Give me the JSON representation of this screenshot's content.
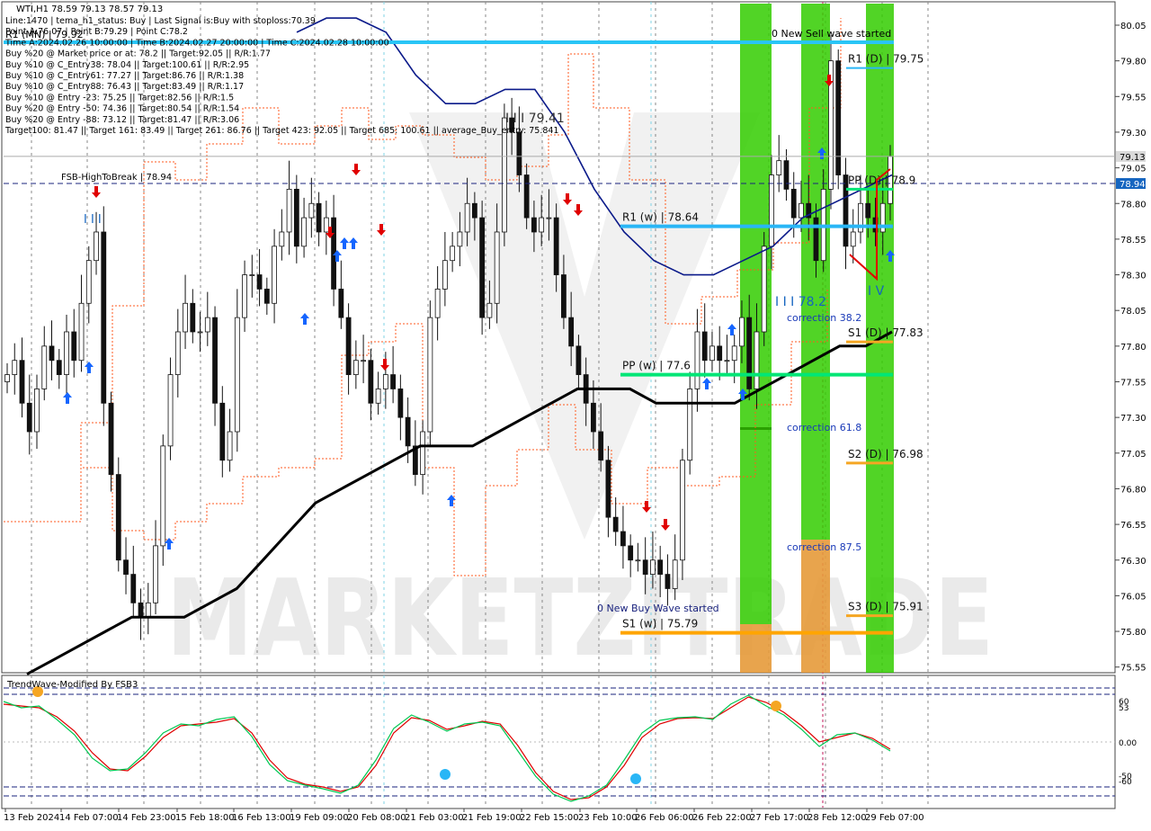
{
  "window": {
    "symbol_line": "WTI,H1  78.59 79.13 78.57 79.13",
    "info_lines": [
      "Line:1470 | tema_h1_status: Buy | Last Signal is:Buy with stoploss:70.39",
      "Point A:76.07 | Point B:79.29 | Point C:78.2",
      "Time A:2024.02.26 10:00:00 | Time B:2024.02.27 20:00:00 | Time C:2024.02.28 10:00:00",
      "Buy %20 @ Market price or at: 78.2 || Target:92.05 || R/R:1.77",
      "Buy %10 @ C_Entry38: 78.04 || Target:100.61 || R/R:2.95",
      "Buy %10 @ C_Entry61: 77.27 || Target:86.76 || R/R:1.38",
      "Buy %10 @ C_Entry88: 76.43 || Target:83.49 || R/R:1.17",
      "Buy %10 @ Entry -23: 75.25 || Target:82.56 || R/R:1.5",
      "Buy %20 @ Entry -50: 74.36 || Target:80.54 || R/R:1.54",
      "Buy %20 @ Entry -88: 73.12 || Target:81.47 || R/R:3.06",
      "Target100: 81.47 || Target 161: 83.49 || Target 261: 86.76 || Target 423: 92.05 || Target 685: 100.61 || average_Buy_entry: 75.841"
    ],
    "r1_mn_label": "R1 (MN) | 79.92",
    "watermark": "MARKETZITRADE"
  },
  "annotations": {
    "fsb_high_to_break": "FSB-HighToBreak | 78.94",
    "wave_high": "I I I 79.41",
    "wave_c": "I I I 78.2",
    "wave_iv": "I V",
    "wave_start_top": "I I I",
    "new_sell_wave": "0 New Sell wave started",
    "new_buy_wave": "0 New Buy Wave started",
    "correction_38": "correction 38.2",
    "correction_61": "correction 61.8",
    "correction_87": "correction 87.5"
  },
  "levels": [
    {
      "label": "R1 (D) | 79.75",
      "price": 79.75,
      "color": "#29b6f6"
    },
    {
      "label": "PP (D) | 78.9",
      "price": 78.9,
      "color": "#00e676"
    },
    {
      "label": "R1 (w) | 78.64",
      "price": 78.64,
      "color": "#29b6f6"
    },
    {
      "label": "S1 (D) | 77.83",
      "price": 77.83,
      "color": "#f5a623"
    },
    {
      "label": "PP (w) | 77.6",
      "price": 77.6,
      "color": "#00e676"
    },
    {
      "label": "S2 (D) | 76.98",
      "price": 76.98,
      "color": "#f5a623"
    },
    {
      "label": "S3 (D) | 75.91",
      "price": 75.91,
      "color": "#f5a623"
    },
    {
      "label": "S1 (w) | 75.79",
      "price": 75.79,
      "color": "#ffa500"
    }
  ],
  "price_axis": {
    "ticks": [
      "80.05",
      "79.80",
      "79.55",
      "79.30",
      "79.05",
      "78.80",
      "78.55",
      "78.30",
      "78.05",
      "77.80",
      "77.55",
      "77.30",
      "77.05",
      "76.80",
      "76.55",
      "76.30",
      "76.05",
      "75.80",
      "75.55"
    ],
    "current_price": "79.13",
    "current_price_color": "#d9d9d9",
    "fsb_price": "78.94",
    "fsb_price_color": "#1565c0"
  },
  "time_axis": {
    "labels": [
      "13 Feb 2024",
      "14 Feb 07:00",
      "14 Feb 23:00",
      "15 Feb 18:00",
      "16 Feb 13:00",
      "19 Feb 09:00",
      "20 Feb 08:00",
      "21 Feb 03:00",
      "21 Feb 19:00",
      "22 Feb 15:00",
      "23 Feb 10:00",
      "26 Feb 06:00",
      "26 Feb 22:00",
      "27 Feb 17:00",
      "28 Feb 12:00",
      "29 Feb 07:00"
    ]
  },
  "indicator": {
    "title": "TrendWave-Modified By FSB3",
    "ticks": [
      "60",
      "53",
      "0.00",
      "-50",
      "-60"
    ]
  },
  "chart_data": {
    "type": "candlestick",
    "symbol": "WTI",
    "timeframe": "H1",
    "ohlc_last": {
      "open": 78.59,
      "high": 79.13,
      "low": 78.57,
      "close": 79.13
    },
    "ylim": [
      75.5,
      80.1
    ],
    "series": [
      {
        "name": "price (approx close)",
        "values": [
          77.6,
          77.7,
          77.4,
          77.2,
          77.5,
          77.8,
          77.7,
          77.6,
          77.9,
          77.7,
          78.1,
          78.4,
          78.6,
          77.4,
          76.9,
          76.3,
          76.2,
          76.0,
          75.9,
          76.0,
          76.4,
          77.1,
          77.6,
          77.9,
          78.1,
          77.9,
          77.9,
          78.0,
          77.4,
          77.0,
          77.2,
          78.0,
          78.3,
          78.3,
          78.2,
          78.1,
          78.5,
          78.6,
          78.9,
          78.5,
          78.7,
          78.8,
          78.6,
          78.7,
          78.2,
          78.0,
          77.6,
          77.7,
          77.7,
          77.4,
          77.5,
          77.6,
          77.5,
          77.3,
          77.1,
          76.9,
          77.2,
          78.0,
          78.2,
          78.4,
          78.5,
          78.6,
          78.8,
          78.7,
          78.0,
          78.1,
          78.6,
          79.4,
          79.3,
          79.0,
          78.7,
          78.6,
          78.7,
          78.7,
          78.3,
          78.0,
          77.8,
          77.6,
          77.4,
          77.2,
          77.0,
          76.6,
          76.5,
          76.4,
          76.3,
          76.3,
          76.2,
          76.3,
          76.2,
          76.1,
          76.3,
          77.0,
          77.5,
          77.9,
          77.7,
          77.8,
          77.7,
          77.7,
          77.8,
          78.0,
          77.5,
          77.9,
          78.5,
          79.0,
          79.1,
          78.9,
          78.7,
          78.8,
          78.7,
          78.4,
          78.9,
          79.8,
          79.0,
          78.5,
          78.6,
          78.8,
          78.7,
          78.6,
          78.8,
          79.13
        ]
      },
      {
        "name": "moving average (black)",
        "values": [
          75.5,
          75.6,
          75.7,
          75.8,
          75.9,
          75.9,
          75.9,
          76.0,
          76.1,
          76.3,
          76.5,
          76.7,
          76.8,
          76.9,
          77.0,
          77.1,
          77.1,
          77.1,
          77.2,
          77.3,
          77.4,
          77.5,
          77.5,
          77.5,
          77.4,
          77.4,
          77.4,
          77.4,
          77.5,
          77.6,
          77.7,
          77.8,
          77.8,
          77.9
        ]
      },
      {
        "name": "moving average (navy)",
        "values": [
          80.0,
          80.1,
          80.1,
          80.0,
          79.7,
          79.5,
          79.5,
          79.6,
          79.6,
          79.3,
          78.9,
          78.6,
          78.4,
          78.3,
          78.3,
          78.4,
          78.5,
          78.7,
          78.8,
          78.9,
          79.0
        ]
      }
    ],
    "oscillator": {
      "name": "TrendWave-Modified By FSB3",
      "ylim": [
        -70,
        70
      ],
      "levels": [
        60,
        53,
        0,
        -50,
        -60
      ],
      "green": [
        45,
        38,
        40,
        25,
        8,
        -18,
        -32,
        -30,
        -12,
        10,
        20,
        18,
        25,
        28,
        6,
        -25,
        -43,
        -48,
        -52,
        -57,
        -48,
        -20,
        15,
        30,
        22,
        12,
        20,
        22,
        18,
        -10,
        -38,
        -58,
        -66,
        -60,
        -48,
        -20,
        10,
        24,
        27,
        28,
        25,
        42,
        52,
        40,
        30,
        14,
        -5,
        8,
        10,
        2,
        -10
      ],
      "red": [
        42,
        40,
        38,
        28,
        12,
        -12,
        -30,
        -32,
        -16,
        5,
        18,
        20,
        22,
        26,
        10,
        -20,
        -40,
        -47,
        -50,
        -55,
        -50,
        -26,
        10,
        27,
        24,
        14,
        18,
        23,
        20,
        -4,
        -34,
        -55,
        -64,
        -62,
        -50,
        -26,
        5,
        20,
        26,
        27,
        26,
        38,
        50,
        44,
        33,
        18,
        0,
        5,
        10,
        4,
        -8
      ],
      "markers": [
        {
          "label": "peak",
          "value": 53
        },
        {
          "label": "trough",
          "value": -52
        },
        {
          "label": "trough",
          "value": -57
        },
        {
          "label": "peak",
          "value": 50
        }
      ]
    }
  }
}
